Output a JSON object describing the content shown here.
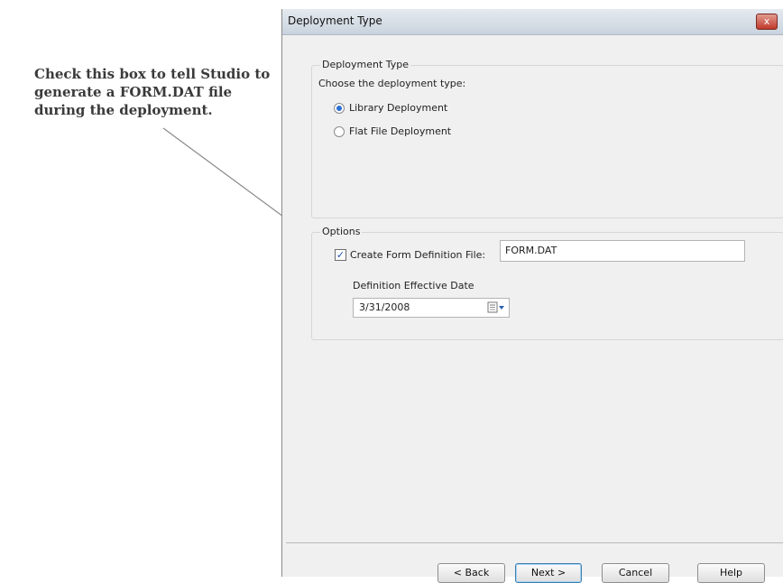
{
  "callout": {
    "text": "Check this box to tell Studio to generate a FORM.DAT file during the deployment."
  },
  "dialog": {
    "title": "Deployment Type",
    "close_label": "x"
  },
  "deployment_group": {
    "label": "Deployment Type",
    "prompt": "Choose the deployment type:",
    "options": [
      {
        "label": "Library Deployment",
        "selected": true
      },
      {
        "label": "Flat File Deployment",
        "selected": false
      }
    ]
  },
  "options_group": {
    "label": "Options",
    "checkbox_label": "Create Form Definition File:",
    "checkbox_checked": true,
    "file_value": "FORM.DAT",
    "date_label": "Definition Effective Date",
    "date_value": "3/31/2008"
  },
  "buttons": {
    "back": "< Back",
    "next": "Next >",
    "cancel": "Cancel",
    "help": "Help"
  }
}
